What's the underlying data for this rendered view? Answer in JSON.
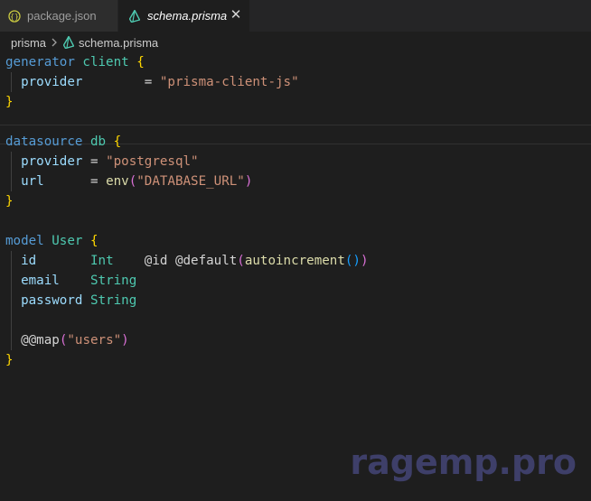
{
  "tabs": [
    {
      "label": "package.json",
      "icon": "json-file-icon"
    },
    {
      "label": "schema.prisma",
      "icon": "prisma-icon",
      "close": "✕"
    }
  ],
  "breadcrumb": {
    "folder": "prisma",
    "file": "schema.prisma"
  },
  "code": {
    "l1": {
      "kw": "generator",
      "name": "client",
      "brace": "{"
    },
    "l2": {
      "field": "provider",
      "eq": "=",
      "value": "\"prisma-client-js\""
    },
    "l3": {
      "brace": "}"
    },
    "l5": {
      "kw": "datasource",
      "name": "db",
      "brace": "{"
    },
    "l6": {
      "field": "provider",
      "eq": "=",
      "value": "\"postgresql\""
    },
    "l7": {
      "field": "url",
      "eq": "=",
      "fn": "env",
      "open": "(",
      "value": "\"DATABASE_URL\"",
      "close": ")"
    },
    "l8": {
      "brace": "}"
    },
    "l10": {
      "kw": "model",
      "name": "User",
      "brace": "{"
    },
    "l11": {
      "field": "id",
      "type": "Int",
      "attr1": "@id",
      "attr2": "@default",
      "open": "(",
      "fn": "autoincrement",
      "inner": "()",
      "close": ")"
    },
    "l12": {
      "field": "email",
      "type": "String"
    },
    "l13": {
      "field": "password",
      "type": "String"
    },
    "l15": {
      "attr": "@@map",
      "open": "(",
      "value": "\"users\"",
      "close": ")"
    },
    "l16": {
      "brace": "}"
    }
  },
  "watermark": "ragemp.pro"
}
